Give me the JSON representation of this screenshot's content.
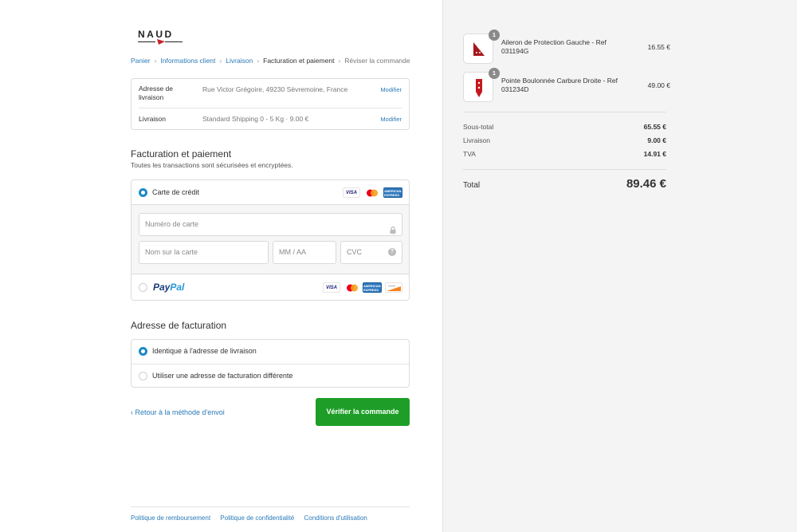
{
  "brand": {
    "name": "NAUD"
  },
  "breadcrumb": [
    "Panier",
    "Informations client",
    "Livraison",
    "Facturation et paiement",
    "Réviser la commande"
  ],
  "info": {
    "rows": [
      {
        "label": "Adresse de livraison",
        "value": "Rue Victor Grégoire, 49230 Sèvremoine, France",
        "action": "Modifier"
      },
      {
        "label": "Livraison",
        "value": "Standard Shipping 0 - 5 Kg · 9.00 €",
        "action": "Modifier"
      }
    ]
  },
  "payment": {
    "title": "Facturation et paiement",
    "subtitle": "Toutes les transactions sont sécurisées et encryptées.",
    "credit_card_label": "Carte de crédit",
    "card_brands": [
      "VISA",
      "MasterCard",
      "AMERICAN EXPRESS",
      "Discover"
    ],
    "fields": {
      "card_number": "Numéro de carte",
      "name": "Nom sur la carte",
      "expiry": "MM / AA",
      "cvc": "CVC"
    },
    "paypal": {
      "pay": "Pay",
      "pal": "Pal"
    },
    "selected": "Carte de crédit"
  },
  "billing": {
    "title": "Adresse de facturation",
    "options": [
      "Identique à l'adresse de livraison",
      "Utiliser une adresse de facturation différente"
    ],
    "selected": "Identique à l'adresse de livraison"
  },
  "actions": {
    "back": "‹ Retour à la méthode d'envoi",
    "verify": "Vérifier la commande"
  },
  "footer": [
    "Politique de remboursement",
    "Politique de confidentialité",
    "Conditions d'utilisation"
  ],
  "cart": {
    "items": [
      {
        "name": "Aileron de Protection Gauche - Ref 031194G",
        "price": "16.55 €",
        "qty": "1"
      },
      {
        "name": "Pointe Boulonnée Carbure Droite - Ref 031234D",
        "price": "49.00 €",
        "qty": "1"
      }
    ],
    "summary": [
      {
        "label": "Sous-total",
        "value": "65.55 €"
      },
      {
        "label": "Livraison",
        "value": "9.00 €"
      },
      {
        "label": "TVA",
        "value": "14.91 €"
      }
    ],
    "total_label": "Total",
    "total_value": "89.46 €"
  },
  "colors": {
    "accent": "#2a7ab8",
    "button": "#1e9e28",
    "radio": "#1b8ac7",
    "product": "#b11c24"
  }
}
